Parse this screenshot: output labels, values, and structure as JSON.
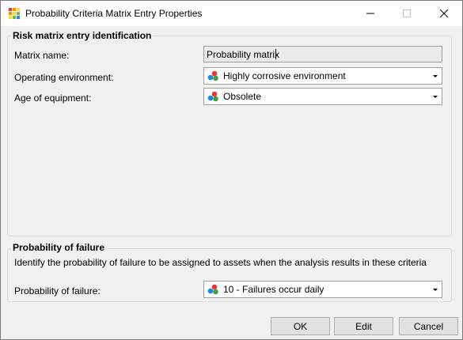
{
  "window": {
    "title": "Probability Criteria Matrix Entry Properties",
    "controls": {
      "minimize": "minimize-icon",
      "maximize": "maximize-icon",
      "close": "close-icon"
    }
  },
  "identification": {
    "group_title": "Risk matrix entry identification",
    "matrix_name_label": "Matrix name:",
    "matrix_name_value": "Probability matrix",
    "operating_environment_label": "Operating environment:",
    "operating_environment_value": "Highly corrosive environment",
    "age_label": "Age of equipment:",
    "age_value": "Obsolete"
  },
  "probability": {
    "group_title": "Probability of failure",
    "description": "Identify the probability of failure to be assigned to assets when the analysis results in these criteria",
    "label": "Probability of failure:",
    "value": "10 - Failures occur daily"
  },
  "buttons": {
    "ok": "OK",
    "edit": "Edit",
    "cancel": "Cancel"
  },
  "icons": {
    "app": "matrix-app-icon",
    "item": "colored-balls-icon",
    "dropdown": "chevron-down-icon"
  }
}
